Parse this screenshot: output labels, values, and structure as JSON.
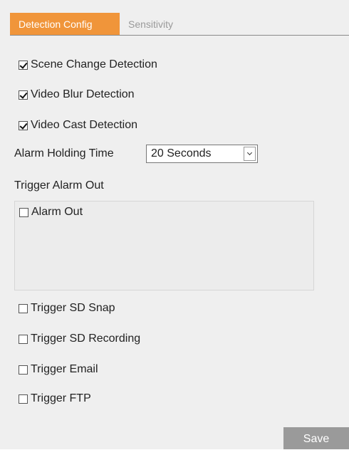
{
  "tabs": [
    {
      "label": "Detection Config",
      "active": true
    },
    {
      "label": "Sensitivity",
      "active": false
    }
  ],
  "detections": {
    "scene_change": {
      "label": "Scene Change Detection",
      "checked": true
    },
    "video_blur": {
      "label": "Video Blur Detection",
      "checked": true
    },
    "video_cast": {
      "label": "Video Cast Detection",
      "checked": true
    }
  },
  "alarm_holding_time": {
    "label": "Alarm Holding Time",
    "value": "20 Seconds"
  },
  "trigger_alarm_out": {
    "label": "Trigger Alarm Out",
    "alarm_out": {
      "label": "Alarm Out",
      "checked": false
    }
  },
  "triggers": {
    "sd_snap": {
      "label": "Trigger SD Snap",
      "checked": false
    },
    "sd_recording": {
      "label": "Trigger SD Recording",
      "checked": false
    },
    "email": {
      "label": "Trigger Email",
      "checked": false
    },
    "ftp": {
      "label": "Trigger FTP",
      "checked": false
    }
  },
  "actions": {
    "save_label": "Save"
  },
  "colors": {
    "accent": "#f0953a",
    "panel_bg": "#efefef",
    "save_bg": "#9a9a9a"
  }
}
